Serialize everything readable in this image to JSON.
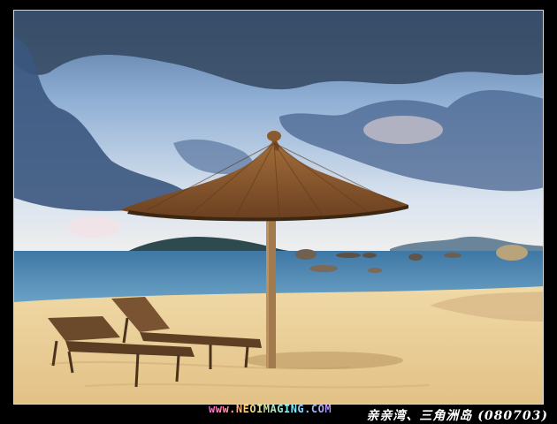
{
  "photo": {
    "subject": "Beach scene with thatched umbrella and two lounge chairs"
  },
  "watermark": {
    "text": "www.NEOIMAGING.COM"
  },
  "caption": {
    "text": "亲亲湾、三角洲岛 (080703)"
  },
  "colors": {
    "sky_top": "#7f9fc9",
    "sky_horizon": "#eef1f6",
    "sea": "#4f88b3",
    "sand": "#e8cc92",
    "thatch": "#8a5a2e"
  }
}
